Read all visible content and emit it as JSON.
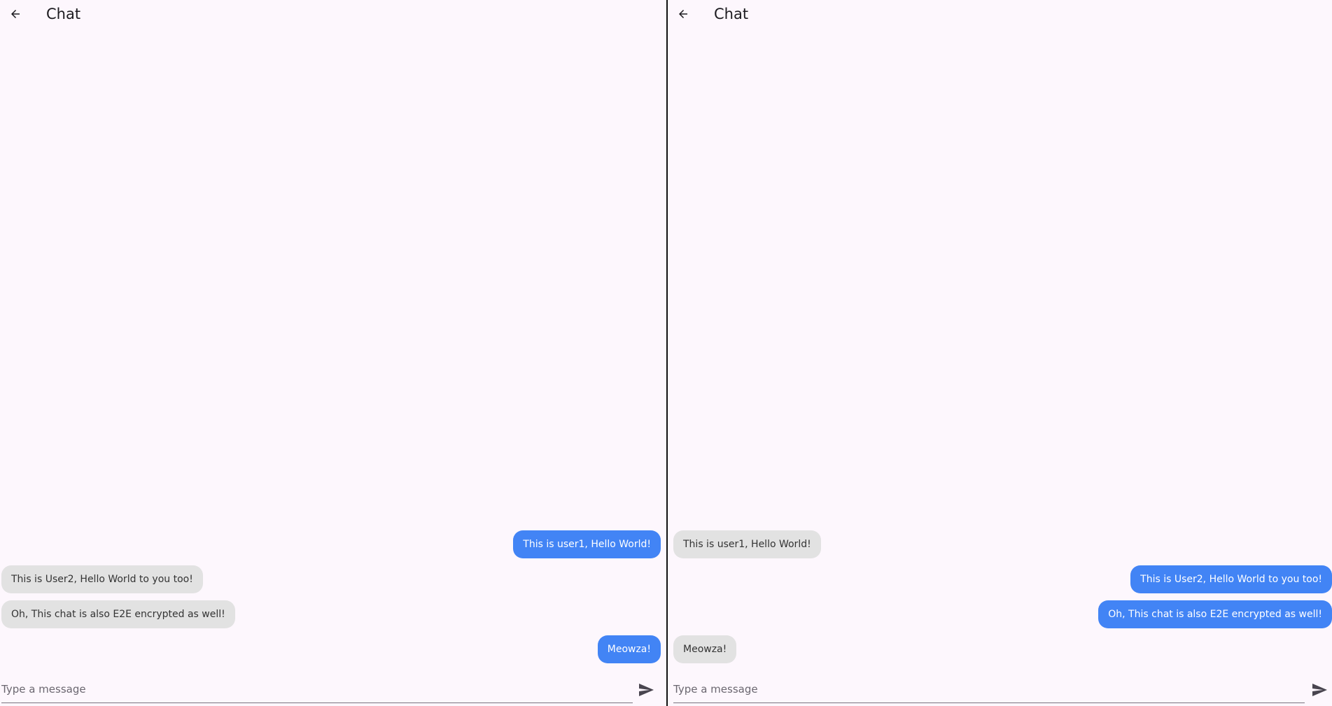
{
  "icons": {
    "back": "arrow-left-icon",
    "send": "send-icon"
  },
  "colors": {
    "background": "#fdf7fd",
    "outgoing_bubble": "#4284f5",
    "incoming_bubble": "#e2e2e2",
    "divider": "#111111"
  },
  "panes": [
    {
      "title": "Chat",
      "messages": [
        {
          "text": "This is user1, Hello World!",
          "direction": "out"
        },
        {
          "text": "This is User2, Hello World to you too!",
          "direction": "in"
        },
        {
          "text": "Oh, This chat is also E2E encrypted as well!",
          "direction": "in"
        },
        {
          "text": "Meowza!",
          "direction": "out"
        }
      ],
      "input_placeholder": "Type a message",
      "input_value": ""
    },
    {
      "title": "Chat",
      "messages": [
        {
          "text": "This is user1, Hello World!",
          "direction": "in"
        },
        {
          "text": "This is User2, Hello World to you too!",
          "direction": "out"
        },
        {
          "text": "Oh, This chat is also E2E encrypted as well!",
          "direction": "out"
        },
        {
          "text": "Meowza!",
          "direction": "in"
        }
      ],
      "input_placeholder": "Type a message",
      "input_value": ""
    }
  ]
}
